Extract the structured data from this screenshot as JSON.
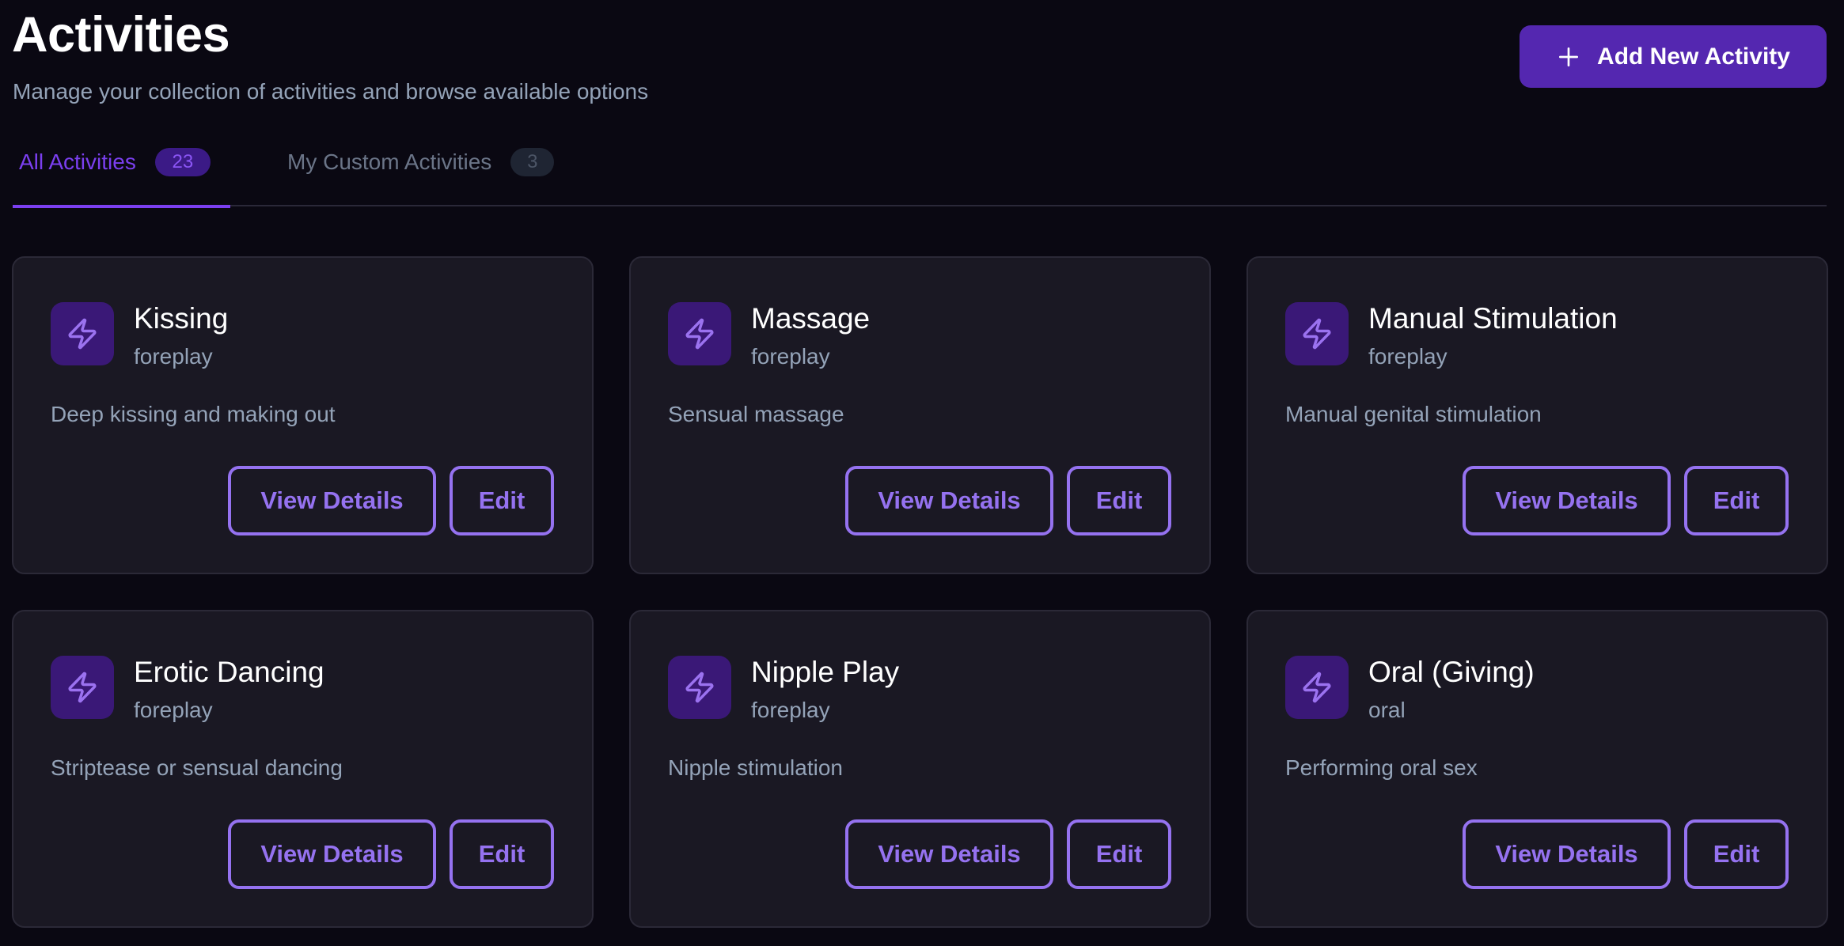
{
  "header": {
    "title": "Activities",
    "subtitle": "Manage your collection of activities and browse available options",
    "add_button_label": "Add New Activity",
    "add_button_icon": "plus-icon"
  },
  "tabs": [
    {
      "label": "All Activities",
      "count": "23",
      "active": true
    },
    {
      "label": "My Custom Activities",
      "count": "3",
      "active": false
    }
  ],
  "colors": {
    "background": "#0a0812",
    "card_background": "#1a1823",
    "accent": "#7b3ff0",
    "button_primary": "#5427b0",
    "outline_button": "#9572f0",
    "icon_tile": "#3a1877",
    "muted_text": "#94a3b8"
  },
  "activities": [
    {
      "title": "Kissing",
      "category": "foreplay",
      "description": "Deep kissing and making out",
      "icon": "zap-icon",
      "view_label": "View Details",
      "edit_label": "Edit"
    },
    {
      "title": "Massage",
      "category": "foreplay",
      "description": "Sensual massage",
      "icon": "zap-icon",
      "view_label": "View Details",
      "edit_label": "Edit"
    },
    {
      "title": "Manual Stimulation",
      "category": "foreplay",
      "description": "Manual genital stimulation",
      "icon": "zap-icon",
      "view_label": "View Details",
      "edit_label": "Edit"
    },
    {
      "title": "Erotic Dancing",
      "category": "foreplay",
      "description": "Striptease or sensual dancing",
      "icon": "zap-icon",
      "view_label": "View Details",
      "edit_label": "Edit"
    },
    {
      "title": "Nipple Play",
      "category": "foreplay",
      "description": "Nipple stimulation",
      "icon": "zap-icon",
      "view_label": "View Details",
      "edit_label": "Edit"
    },
    {
      "title": "Oral (Giving)",
      "category": "oral",
      "description": "Performing oral sex",
      "icon": "zap-icon",
      "view_label": "View Details",
      "edit_label": "Edit"
    }
  ]
}
